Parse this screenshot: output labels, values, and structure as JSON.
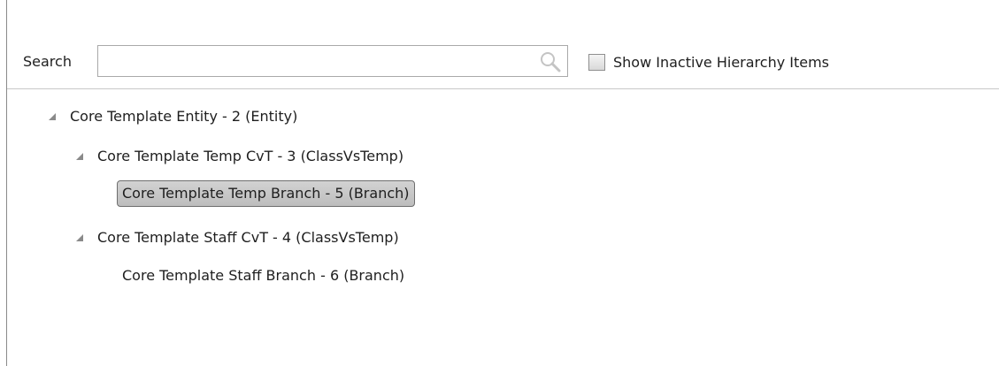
{
  "search": {
    "label": "Search",
    "value": "",
    "placeholder": ""
  },
  "options": {
    "show_inactive_label": "Show Inactive Hierarchy Items",
    "show_inactive_checked": false
  },
  "tree": {
    "items": [
      {
        "label": "Core Template Entity - 2 (Entity)",
        "expanded": true,
        "selected": false
      },
      {
        "label": "Core Template Temp CvT - 3 (ClassVsTemp)",
        "expanded": true,
        "selected": false
      },
      {
        "label": "Core Template Temp Branch - 5 (Branch)",
        "expanded": false,
        "selected": true
      },
      {
        "label": "Core Template Staff CvT - 4 (ClassVsTemp)",
        "expanded": true,
        "selected": false
      },
      {
        "label": "Core Template Staff Branch - 6 (Branch)",
        "expanded": false,
        "selected": false
      }
    ]
  },
  "icons": {
    "search": "search-icon",
    "expander": "expanded-triangle-icon"
  },
  "colors": {
    "selection_bg": "#c9c9c9",
    "selection_border": "#6e6e6e",
    "expander": "#8a8a8a"
  }
}
